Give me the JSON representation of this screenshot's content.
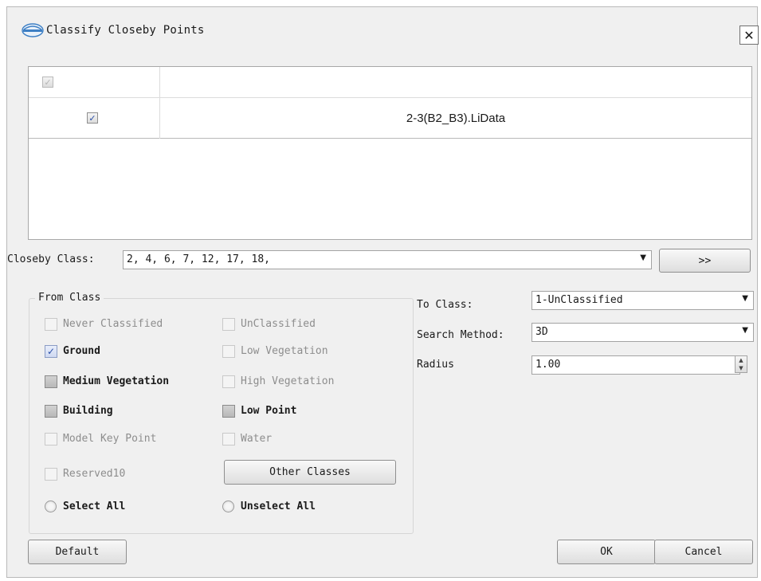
{
  "window": {
    "title": "Classify Closeby Points",
    "close_glyph": "✕",
    "logo_icon": "app-logo-icon"
  },
  "file_table": {
    "header_checked": true,
    "rows": [
      {
        "checked": true,
        "name": "2-3(B2_B3).LiData"
      }
    ]
  },
  "closeby": {
    "label": "Closeby Class:",
    "value": "2, 4, 6, 7, 12, 17, 18,",
    "more_label": ">>"
  },
  "from_class": {
    "title": "From Class",
    "items": [
      {
        "label": "Never Classified",
        "checked": false,
        "enabled": false
      },
      {
        "label": "UnClassified",
        "checked": false,
        "enabled": false
      },
      {
        "label": "Ground",
        "checked": true,
        "enabled": true
      },
      {
        "label": "Low Vegetation",
        "checked": false,
        "enabled": false
      },
      {
        "label": "Medium Vegetation",
        "checked": false,
        "enabled": true
      },
      {
        "label": "High Vegetation",
        "checked": false,
        "enabled": false
      },
      {
        "label": "Building",
        "checked": false,
        "enabled": true
      },
      {
        "label": "Low Point",
        "checked": false,
        "enabled": true
      },
      {
        "label": "Model Key Point",
        "checked": false,
        "enabled": false
      },
      {
        "label": "Water",
        "checked": false,
        "enabled": false
      },
      {
        "label": "Reserved10",
        "checked": false,
        "enabled": false
      }
    ],
    "other_classes_label": "Other Classes",
    "select_all_label": "Select All",
    "unselect_all_label": "Unselect All"
  },
  "to_class": {
    "label": "To Class:",
    "value": "1-UnClassified"
  },
  "search_method": {
    "label": "Search Method:",
    "value": "3D"
  },
  "radius": {
    "label": "Radius",
    "value": "1.00"
  },
  "buttons": {
    "default_label": "Default",
    "ok_label": "OK",
    "cancel_label": "Cancel"
  }
}
